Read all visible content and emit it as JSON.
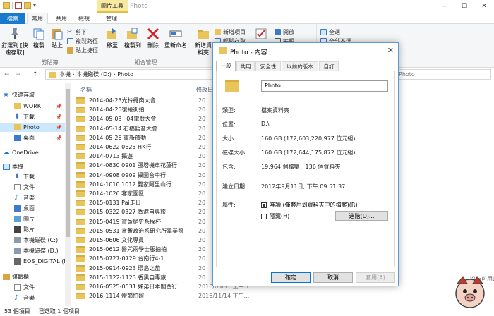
{
  "titlebar": {
    "context_tab": "圖片工具",
    "title": "Photo",
    "minimize": "—",
    "maximize": "☐",
    "close": "✕"
  },
  "ribbon_tabs": {
    "file": "檔案",
    "home": "常用",
    "share": "共用",
    "view": "檢視",
    "manage": "管理"
  },
  "ribbon": {
    "pin_label": "釘選到 [快速存取]",
    "copy_label": "複製",
    "paste_label": "貼上",
    "cut_label": "剪下",
    "copy_path_label": "複製路徑",
    "paste_shortcut_label": "貼上捷徑",
    "clipboard_group": "剪貼簿",
    "move_label": "移至",
    "copy_to_label": "複製到",
    "delete_label": "刪除",
    "rename_label": "重新命名",
    "organize_group": "組合管理",
    "new_folder_label": "新增資料夾",
    "new_item_label": "新增項目",
    "easy_access_label": "輕鬆存取",
    "open_label": "開啟",
    "edit_label": "編輯",
    "select_all_label": "全選",
    "select_none_label": "全部不選"
  },
  "address": {
    "back": "←",
    "forward": "→",
    "up": "↑",
    "path": "本機  ›  本機磁碟 (D:)  ›  Photo",
    "search_placeholder": "Photo"
  },
  "nav": {
    "quick_access": "快速存取",
    "items": [
      "WORK",
      "下載",
      "Photo",
      "桌面"
    ],
    "onedrive": "OneDrive",
    "this_pc": "本機",
    "pc_items": [
      "下載",
      "文件",
      "音樂",
      "桌面",
      "圖片",
      "影片",
      "本機磁碟 (C:)",
      "本機磁碟 (D:)",
      "EOS_DIGITAL (F"
    ],
    "network": "媒體櫃",
    "lib_items": [
      "文件",
      "音樂"
    ]
  },
  "columns": {
    "name": "名稱",
    "date": "修改日"
  },
  "files": [
    {
      "name": "2014-04-23光柃繩肉大會",
      "date": "20"
    },
    {
      "name": "2014-04-25復捲衝拍",
      "date": "20"
    },
    {
      "name": "2014-05-03~04電競大會",
      "date": "20"
    },
    {
      "name": "2014-05-14 石橋語音大會",
      "date": "20"
    },
    {
      "name": "2014-05-26 重新啟動",
      "date": "20"
    },
    {
      "name": "2014-0622 0625 HK行",
      "date": "20"
    },
    {
      "name": "2014-0713 攝遊",
      "date": "20"
    },
    {
      "name": "2014-0830 0901 蛋塔機車花蓮行",
      "date": "20"
    },
    {
      "name": "2014-0908 0909 攝圖台中行",
      "date": "20"
    },
    {
      "name": "2014-1010 1012 雙家阿里山行",
      "date": "20"
    },
    {
      "name": "2014-1026 客家園區",
      "date": "20"
    },
    {
      "name": "2015-0131 Pai走日",
      "date": "20"
    },
    {
      "name": "2015-0322 0327 香港自專旅",
      "date": "20"
    },
    {
      "name": "2015-0419 賞黃歷史系探杯",
      "date": "20"
    },
    {
      "name": "2015-0531 賞黃政治系研究所畢業照",
      "date": "20"
    },
    {
      "name": "2015-0606 文化專員",
      "date": "20"
    },
    {
      "name": "2015-0612 醫咒兩學士服拍拍",
      "date": "20"
    },
    {
      "name": "2015-0727-0729 台南行4-1",
      "date": "20"
    },
    {
      "name": "2015-0914-0923 環島之旅",
      "date": "20"
    },
    {
      "name": "2015-1122-1123 香黑自專旅",
      "date": "20"
    },
    {
      "name": "2016-0525-0531 姊弟日本關西行",
      "date": "2016/05/31 上午 1..."
    },
    {
      "name": "2016-1114 燈節拍照",
      "date": "2016/11/14 下午..."
    }
  ],
  "right_hint": "沒有可用的預覽",
  "status": {
    "count": "53 個項目",
    "selected": "已選取 1 個項目"
  },
  "dialog": {
    "title": "Photo - 內容",
    "close": "✕",
    "tabs": [
      "一般",
      "共用",
      "安全性",
      "以前的版本",
      "自訂"
    ],
    "name_value": "Photo",
    "rows": [
      {
        "label": "類型:",
        "value": "檔案資料夾"
      },
      {
        "label": "位置:",
        "value": "D:\\"
      },
      {
        "label": "大小:",
        "value": "160 GB (172,603,220,977 位元組)"
      },
      {
        "label": "磁碟大小:",
        "value": "160 GB (172,644,175,872 位元組)"
      },
      {
        "label": "包含:",
        "value": "19,964 個檔案，136 個資料夾"
      },
      {
        "label": "建立日期:",
        "value": "2012年9月11日, 下午 09:51:37"
      },
      {
        "label": "屬性:",
        "value": ""
      }
    ],
    "readonly_label": "唯讀 (僅套用到資料夾中的檔案)(R)",
    "hidden_label": "隱藏(H)",
    "advanced_button": "進階(D)...",
    "ok_button": "確定",
    "cancel_button": "取消",
    "apply_button": "套用(A)"
  },
  "colors": {
    "accent": "#1979ca",
    "selection": "#cce8ff",
    "folder": "#e8c45a"
  }
}
